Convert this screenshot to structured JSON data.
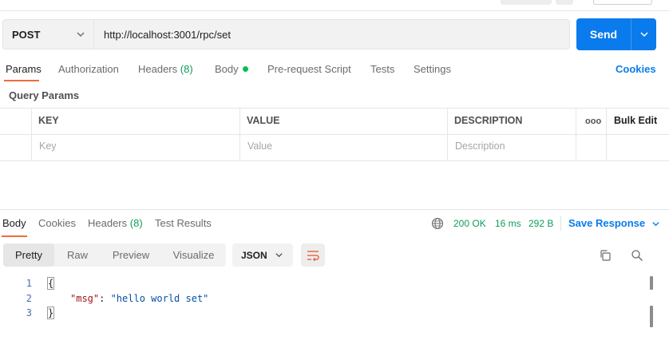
{
  "request": {
    "method": "POST",
    "url": "http://localhost:3001/rpc/set",
    "send_label": "Send"
  },
  "request_tabs": {
    "params": "Params",
    "authorization": "Authorization",
    "headers": "Headers",
    "headers_count": "(8)",
    "body": "Body",
    "pre_request": "Pre-request Script",
    "tests": "Tests",
    "settings": "Settings",
    "cookies": "Cookies"
  },
  "query_params": {
    "title": "Query Params",
    "columns": {
      "key": "KEY",
      "value": "VALUE",
      "description": "DESCRIPTION"
    },
    "more": "ooo",
    "bulk_edit": "Bulk Edit",
    "placeholders": {
      "key": "Key",
      "value": "Value",
      "description": "Description"
    }
  },
  "response_tabs": {
    "body": "Body",
    "cookies": "Cookies",
    "headers": "Headers",
    "headers_count": "(8)",
    "test_results": "Test Results"
  },
  "response_meta": {
    "status": "200 OK",
    "time": "16 ms",
    "size": "292 B",
    "save": "Save Response"
  },
  "view": {
    "options": [
      "Pretty",
      "Raw",
      "Preview",
      "Visualize"
    ],
    "active": "Pretty",
    "format": "JSON"
  },
  "code": {
    "line_numbers": [
      "1",
      "2",
      "3"
    ],
    "open_brace": "{",
    "close_brace": "}",
    "key": "\"msg\"",
    "colon": ": ",
    "value": "\"hello world set\""
  },
  "colors": {
    "accent": "#097bed",
    "active_tab": "#f26b3a",
    "success": "#0f9d58"
  }
}
